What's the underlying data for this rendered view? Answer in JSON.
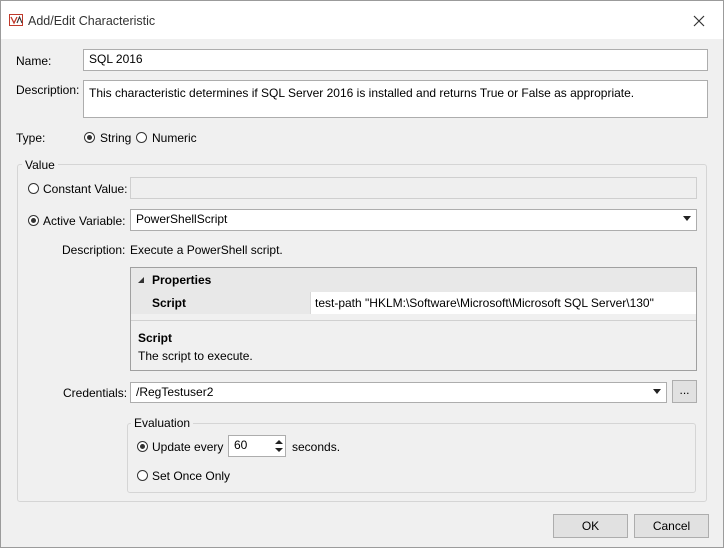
{
  "window": {
    "title": "Add/Edit Characteristic"
  },
  "name": {
    "label": "Name:",
    "value": "SQL 2016"
  },
  "description": {
    "label": "Description:",
    "value": "This characteristic determines if SQL Server 2016 is installed and returns True or False as appropriate."
  },
  "type": {
    "label": "Type:",
    "options": [
      "String",
      "Numeric"
    ],
    "selected": "String"
  },
  "value_group": {
    "legend": "Value",
    "constant_label": "Constant Value:",
    "constant_value": "",
    "active_label": "Active Variable:",
    "active_selected": "PowerShellScript",
    "var_description_label": "Description:",
    "var_description": "Execute a PowerShell script.",
    "properties": {
      "header": "Properties",
      "rows": [
        {
          "name": "Script",
          "value": "test-path \"HKLM:\\Software\\Microsoft\\Microsoft SQL Server\\130\""
        }
      ],
      "help_title": "Script",
      "help_text": "The script to execute."
    },
    "credentials_label": "Credentials:",
    "credentials_value": "/RegTestuser2",
    "browse_label": "...",
    "evaluation": {
      "legend": "Evaluation",
      "update_label": "Update every",
      "interval": "60",
      "seconds_label": "seconds.",
      "once_label": "Set Once Only"
    }
  },
  "buttons": {
    "ok": "OK",
    "cancel": "Cancel"
  }
}
